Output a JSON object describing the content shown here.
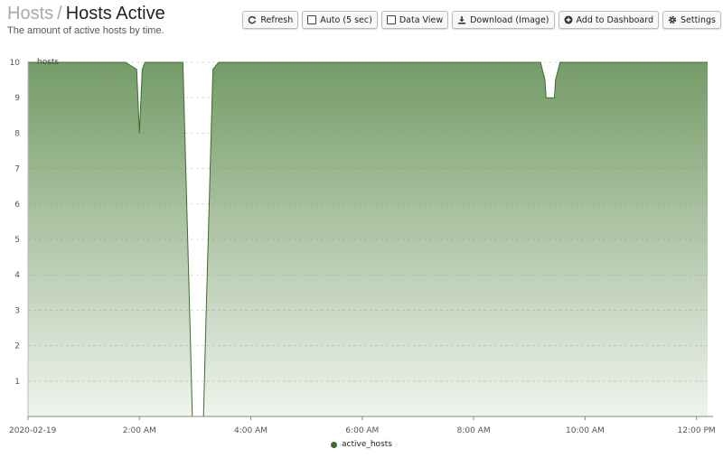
{
  "header": {
    "breadcrumb_parent": "Hosts",
    "separator": "/",
    "title": "Hosts Active",
    "subtitle": "The amount of active hosts by time."
  },
  "toolbar": {
    "refresh_label": "Refresh",
    "auto_label": "Auto (5 sec)",
    "data_view_label": "Data View",
    "download_label": "Download (Image)",
    "add_dashboard_label": "Add to Dashboard",
    "settings_label": "Settings"
  },
  "colors": {
    "series": "#5c8a4c",
    "line": "#3f6b30",
    "legend_dot": "#3f6b30",
    "gridline": "#dddddd"
  },
  "chart_data": {
    "type": "area",
    "ylabel": "hosts",
    "ylim": [
      0,
      10
    ],
    "yticks": [
      1,
      2,
      3,
      4,
      5,
      6,
      7,
      8,
      9,
      10
    ],
    "xlim": [
      0,
      12.2
    ],
    "xtick_values": [
      0,
      2,
      4,
      6,
      8,
      10,
      12
    ],
    "xtick_labels": [
      "2020-02-19",
      "2:00 AM",
      "4:00 AM",
      "6:00 AM",
      "8:00 AM",
      "10:00 AM",
      "12:00 PM"
    ],
    "grid": true,
    "legend_position": "bottom-center",
    "series": [
      {
        "name": "active_hosts",
        "x": [
          0,
          1.75,
          1.95,
          2.0,
          2.05,
          2.1,
          2.2,
          2.5,
          2.78,
          2.9,
          2.95,
          3.15,
          3.2,
          3.32,
          3.42,
          9.2,
          9.28,
          9.3,
          9.45,
          9.47,
          9.55,
          12.2
        ],
        "y": [
          10,
          10,
          9.8,
          8,
          9.8,
          10,
          10,
          10,
          10,
          3,
          0,
          0,
          3,
          9.8,
          10,
          10,
          9.5,
          9,
          9,
          9.5,
          10,
          10
        ]
      }
    ]
  }
}
